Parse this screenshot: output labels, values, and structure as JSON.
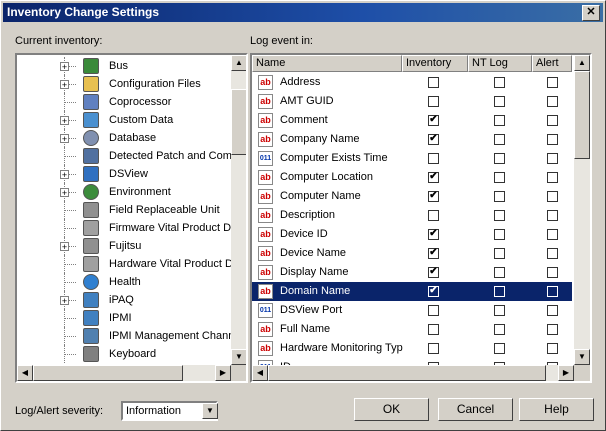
{
  "window": {
    "title": "Inventory Change Settings",
    "close_glyph": "✕"
  },
  "current_inventory_label": "Current inventory:",
  "log_event_label": "Log event in:",
  "tree": [
    {
      "label": "Bus",
      "icon": "bus-icon",
      "expandable": true
    },
    {
      "label": "Configuration Files",
      "icon": "folder-icon",
      "expandable": true
    },
    {
      "label": "Coprocessor",
      "icon": "coprocessor-icon",
      "expandable": false
    },
    {
      "label": "Custom Data",
      "icon": "custom-data-icon",
      "expandable": true
    },
    {
      "label": "Database",
      "icon": "database-icon",
      "expandable": true
    },
    {
      "label": "Detected Patch and Comp",
      "icon": "patch-icon",
      "expandable": false
    },
    {
      "label": "DSView",
      "icon": "dsview-icon",
      "expandable": true
    },
    {
      "label": "Environment",
      "icon": "environment-icon",
      "expandable": true
    },
    {
      "label": "Field Replaceable Unit",
      "icon": "fru-icon",
      "expandable": false
    },
    {
      "label": "Firmware Vital Product Da",
      "icon": "firmware-icon",
      "expandable": false
    },
    {
      "label": "Fujitsu",
      "icon": "fujitsu-icon",
      "expandable": true
    },
    {
      "label": "Hardware Vital Product Da",
      "icon": "hardware-icon",
      "expandable": false
    },
    {
      "label": "Health",
      "icon": "health-icon",
      "expandable": false
    },
    {
      "label": "iPAQ",
      "icon": "ipaq-icon",
      "expandable": true
    },
    {
      "label": "IPMI",
      "icon": "ipmi-icon",
      "expandable": false
    },
    {
      "label": "IPMI Management Channe",
      "icon": "ipmi-channel-icon",
      "expandable": false
    },
    {
      "label": "Keyboard",
      "icon": "keyboard-icon",
      "expandable": false
    }
  ],
  "columns": {
    "name": "Name",
    "inventory": "Inventory",
    "ntlog": "NT Log",
    "alert": "Alert"
  },
  "rows": [
    {
      "name": "Address",
      "type": "ab",
      "inventory": false,
      "ntlog": false,
      "alert": false
    },
    {
      "name": "AMT GUID",
      "type": "ab",
      "inventory": false,
      "ntlog": false,
      "alert": false
    },
    {
      "name": "Comment",
      "type": "ab",
      "inventory": true,
      "ntlog": false,
      "alert": false
    },
    {
      "name": "Company Name",
      "type": "ab",
      "inventory": true,
      "ntlog": false,
      "alert": false
    },
    {
      "name": "Computer Exists Time",
      "type": "num",
      "inventory": false,
      "ntlog": false,
      "alert": false
    },
    {
      "name": "Computer Location",
      "type": "ab",
      "inventory": true,
      "ntlog": false,
      "alert": false
    },
    {
      "name": "Computer Name",
      "type": "ab",
      "inventory": true,
      "ntlog": false,
      "alert": false
    },
    {
      "name": "Description",
      "type": "ab",
      "inventory": false,
      "ntlog": false,
      "alert": false
    },
    {
      "name": "Device ID",
      "type": "ab",
      "inventory": true,
      "ntlog": false,
      "alert": false
    },
    {
      "name": "Device Name",
      "type": "ab",
      "inventory": true,
      "ntlog": false,
      "alert": false
    },
    {
      "name": "Display Name",
      "type": "ab",
      "inventory": true,
      "ntlog": false,
      "alert": false
    },
    {
      "name": "Domain Name",
      "type": "ab",
      "inventory": true,
      "ntlog": false,
      "alert": false,
      "selected": true
    },
    {
      "name": "DSView Port",
      "type": "num",
      "inventory": false,
      "ntlog": false,
      "alert": false
    },
    {
      "name": "Full Name",
      "type": "ab",
      "inventory": false,
      "ntlog": false,
      "alert": false
    },
    {
      "name": "Hardware Monitoring Typ",
      "type": "ab",
      "inventory": false,
      "ntlog": false,
      "alert": false
    },
    {
      "name": "ID",
      "type": "num",
      "inventory": false,
      "ntlog": false,
      "alert": false
    }
  ],
  "severity": {
    "label": "Log/Alert severity:",
    "value": "Information"
  },
  "buttons": {
    "ok": "OK",
    "cancel": "Cancel",
    "help": "Help"
  },
  "colors": {
    "title_bar": "#0a246a",
    "selection": "#0a246a",
    "face": "#d4d0c8"
  }
}
